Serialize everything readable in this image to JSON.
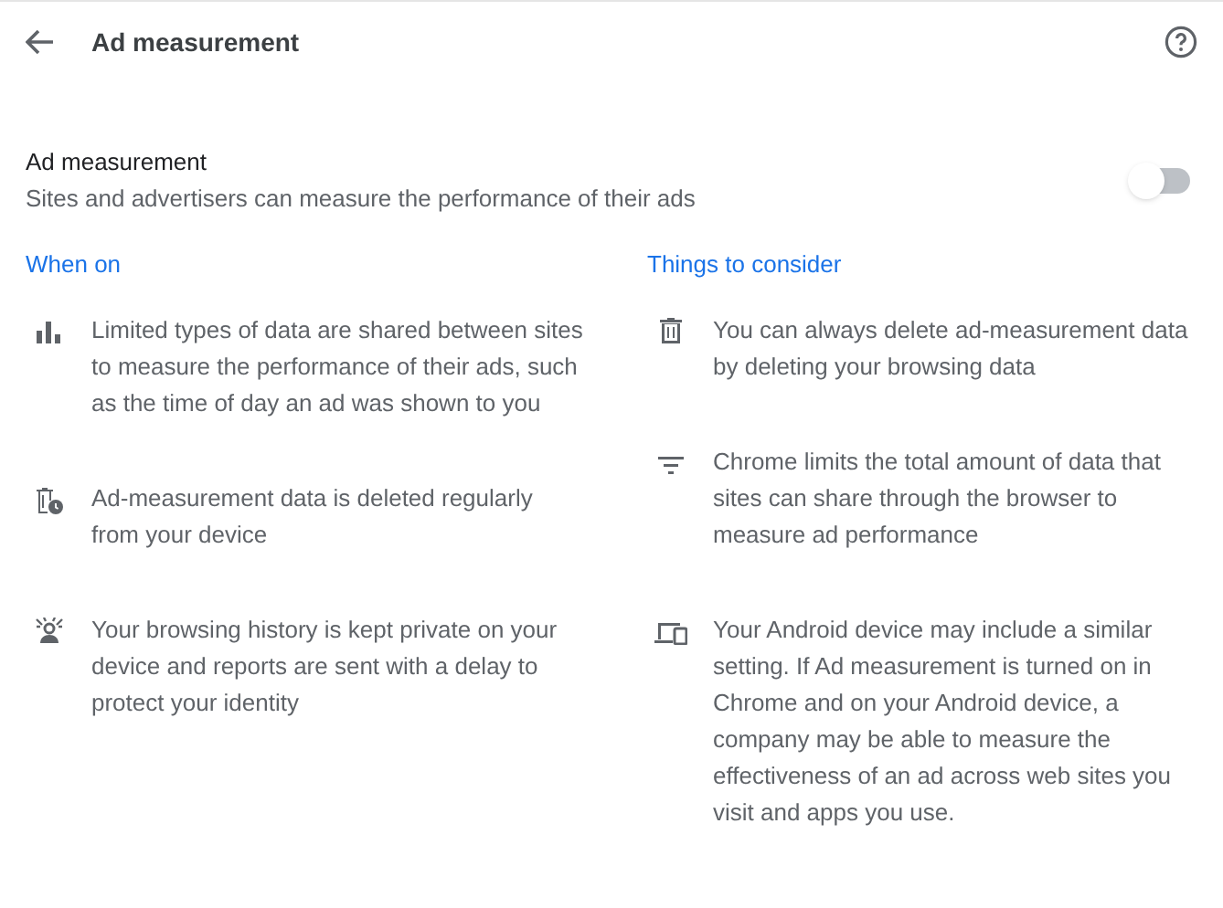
{
  "header": {
    "title": "Ad measurement"
  },
  "setting": {
    "title": "Ad measurement",
    "description": "Sites and advertisers can measure the performance of their ads",
    "on": false
  },
  "columns": [
    {
      "heading": "When on",
      "items": [
        {
          "text": "Limited types of data are shared between sites to measure the performance of their ads, such as the time of day an ad was shown to you"
        },
        {
          "text": "Ad-measurement data is deleted regularly from your device"
        },
        {
          "text": "Your browsing history is kept private on your device and reports are sent with a delay to protect your identity"
        }
      ]
    },
    {
      "heading": "Things to consider",
      "items": [
        {
          "text": "You can always delete ad-measurement data by deleting your browsing data"
        },
        {
          "text": "Chrome limits the total amount of data that sites can share through the browser to measure ad performance"
        },
        {
          "text": "Your Android device may include a similar setting. If Ad measurement is turned on in Chrome and on your Android device, a company may be able to measure the effectiveness of an ad across web sites you visit and apps you use."
        }
      ]
    }
  ]
}
